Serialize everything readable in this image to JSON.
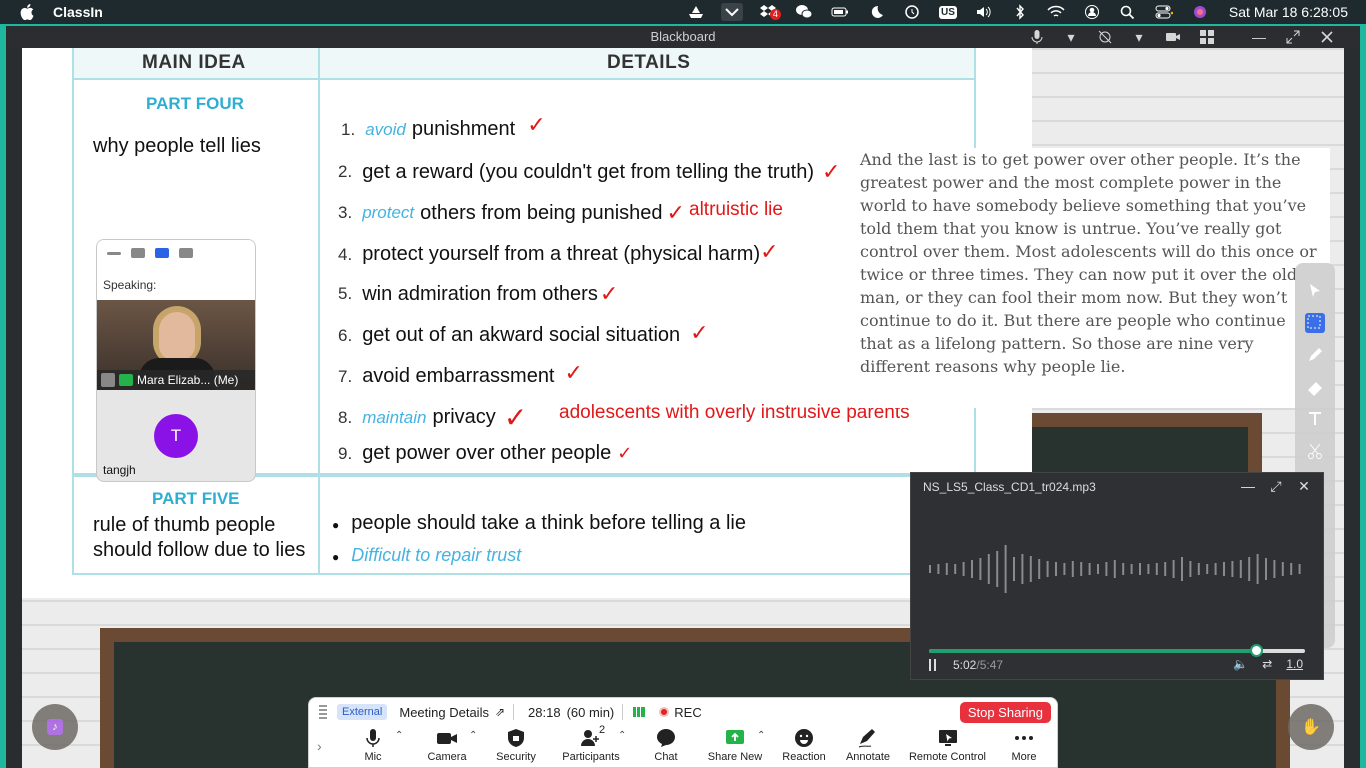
{
  "menubar": {
    "app_name": "ClassIn",
    "badge_count": "4",
    "input_source": "US",
    "clock": "Sat Mar 18  6:28:05"
  },
  "window": {
    "title": "Blackboard"
  },
  "slide": {
    "header_main_idea": "MAIN IDEA",
    "header_details": "DETAILS",
    "part_four": "PART FOUR",
    "part_four_main": "why people tell lies",
    "rows": [
      {
        "num": "1.",
        "blue": "avoid",
        "text": "punishment"
      },
      {
        "num": "2.",
        "blue": "",
        "text": "get a reward (you couldn't get from telling the truth)"
      },
      {
        "num": "3.",
        "blue": "protect",
        "text": "others from being punished"
      },
      {
        "num": "4.",
        "blue": "",
        "text": "protect yourself from a threat (physical harm)"
      },
      {
        "num": "5.",
        "blue": "",
        "text": "win admiration from others"
      },
      {
        "num": "6.",
        "blue": "",
        "text": "get out of an akward social situation"
      },
      {
        "num": "7.",
        "blue": "",
        "text": "avoid embarrassment"
      },
      {
        "num": "8.",
        "blue": "maintain",
        "text": "privacy"
      },
      {
        "num": "9.",
        "blue": "",
        "text": "get power over other people"
      }
    ],
    "note_altruistic": "altruistic lie",
    "note_adolescents": "adolescents with overly instrusive parents",
    "part_five": "PART FIVE",
    "part_five_main_1": "rule of thumb people",
    "part_five_main_2": "should follow due to lies",
    "bullet_1": "people should take a think before telling a lie",
    "bullet_2": "Difficult to repair trust"
  },
  "quote": {
    "text": "And the last is to get power over other people. It’s the greatest power and the most complete power in the world to have somebody believe something that you’ve told them that you know is untrue. You’ve really got control over them. Most adolescents will do this once or twice or three times. They can now put it over the old man, or they can fool their mom now. But they won’t continue to do it. But there are people who continue that as a lifelong pattern. So those are nine very different reasons why people lie."
  },
  "speaker": {
    "label": "Speaking:",
    "name": "Mara Elizab... (Me)",
    "avatar_letter": "T",
    "user": "tangjh"
  },
  "player": {
    "filename": "NS_LS5_Class_CD1_tr024.mp3",
    "current_time": "5:02",
    "total_time": "/5:47",
    "progress": 0.87,
    "speed": "1.0"
  },
  "zoom": {
    "external": "External",
    "meeting_details": "Meeting Details",
    "elapsed": "28:18",
    "duration": "(60 min)",
    "rec": "REC",
    "stop_sharing": "Stop Sharing",
    "participants_count": "2",
    "buttons": {
      "mic": "Mic",
      "camera": "Camera",
      "security": "Security",
      "participants": "Participants",
      "chat": "Chat",
      "share_new": "Share New",
      "reaction": "Reaction",
      "annotate": "Annotate",
      "remote_control": "Remote Control",
      "more": "More"
    }
  },
  "colors": {
    "accent_teal": "#1fb89e",
    "check_red": "#e21818",
    "part_blue": "#2eaed2",
    "stop_red": "#e8313d",
    "progress_green": "#1fa06e"
  }
}
